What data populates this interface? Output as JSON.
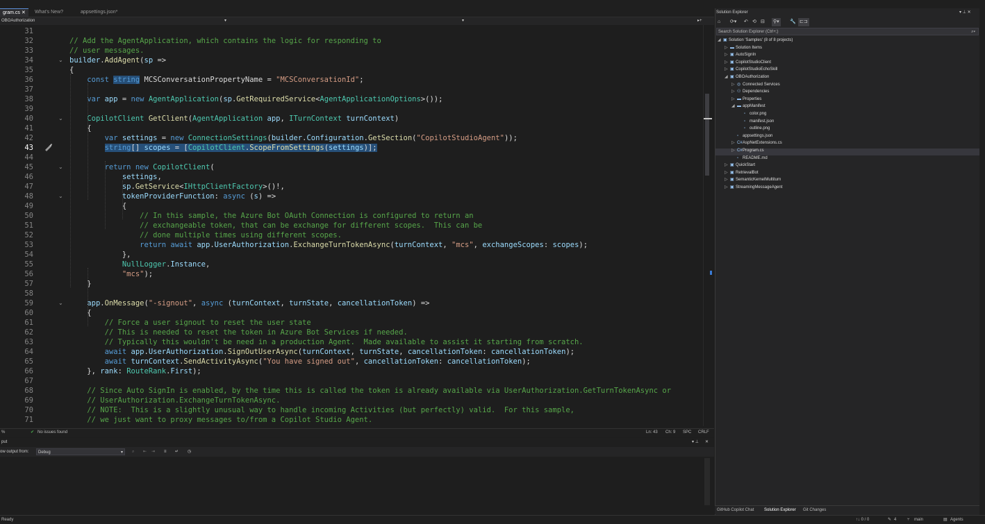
{
  "tabs": [
    {
      "label": "gram.cs",
      "active": true
    },
    {
      "label": "What's New?",
      "active": false
    },
    {
      "label": "appsettings.json*",
      "active": false
    }
  ],
  "navbar": {
    "project": "OBOAuthorization"
  },
  "code_lines": [
    {
      "n": 31,
      "t": []
    },
    {
      "n": 32,
      "t": [
        [
          "cm",
          "// Add the AgentApplication, which contains the logic for responding to"
        ]
      ]
    },
    {
      "n": 33,
      "t": [
        [
          "cm",
          "// user messages."
        ]
      ]
    },
    {
      "n": 34,
      "t": [
        [
          "pa",
          "builder"
        ],
        [
          "id",
          "."
        ],
        [
          "fn",
          "AddAgent"
        ],
        [
          "id",
          "("
        ],
        [
          "pa",
          "sp"
        ],
        [
          "id",
          " =>"
        ]
      ]
    },
    {
      "n": 35,
      "t": [
        [
          "id",
          "{"
        ]
      ]
    },
    {
      "n": 36,
      "t": [
        [
          "id",
          "    "
        ],
        [
          "kw",
          "const "
        ],
        [
          "kw sel",
          "string"
        ],
        [
          "id",
          " MCSConversationPropertyName = "
        ],
        [
          "str",
          "\"MCSConversationId\""
        ],
        [
          "id",
          ";"
        ]
      ]
    },
    {
      "n": 37,
      "t": []
    },
    {
      "n": 38,
      "t": [
        [
          "id",
          "    "
        ],
        [
          "kw",
          "var "
        ],
        [
          "pa",
          "app"
        ],
        [
          "id",
          " = "
        ],
        [
          "kw",
          "new "
        ],
        [
          "ty",
          "AgentApplication"
        ],
        [
          "id",
          "("
        ],
        [
          "pa",
          "sp"
        ],
        [
          "id",
          "."
        ],
        [
          "fn",
          "GetRequiredService"
        ],
        [
          "id",
          "<"
        ],
        [
          "ty",
          "AgentApplicationOptions"
        ],
        [
          "id",
          ">());"
        ]
      ]
    },
    {
      "n": 39,
      "t": []
    },
    {
      "n": 40,
      "t": [
        [
          "id",
          "    "
        ],
        [
          "ty",
          "CopilotClient"
        ],
        [
          "id",
          " "
        ],
        [
          "fn",
          "GetClient"
        ],
        [
          "id",
          "("
        ],
        [
          "ty",
          "AgentApplication"
        ],
        [
          "id",
          " "
        ],
        [
          "pa",
          "app"
        ],
        [
          "id",
          ", "
        ],
        [
          "ty",
          "ITurnContext"
        ],
        [
          "id",
          " "
        ],
        [
          "pa",
          "turnContext"
        ],
        [
          "id",
          ")"
        ]
      ]
    },
    {
      "n": 41,
      "t": [
        [
          "id",
          "    {"
        ]
      ]
    },
    {
      "n": 42,
      "t": [
        [
          "id",
          "        "
        ],
        [
          "kw",
          "var "
        ],
        [
          "pa",
          "settings"
        ],
        [
          "id",
          " = "
        ],
        [
          "kw",
          "new "
        ],
        [
          "ty",
          "ConnectionSettings"
        ],
        [
          "id",
          "("
        ],
        [
          "pa",
          "builder"
        ],
        [
          "id",
          "."
        ],
        [
          "pa",
          "Configuration"
        ],
        [
          "id",
          "."
        ],
        [
          "fn",
          "GetSection"
        ],
        [
          "id",
          "("
        ],
        [
          "str",
          "\"CopilotStudioAgent\""
        ],
        [
          "id",
          "));"
        ]
      ]
    },
    {
      "n": 43,
      "t": [
        [
          "id",
          "        "
        ],
        [
          "kw sel",
          "string"
        ],
        [
          "id sel",
          "[] "
        ],
        [
          "pa sel",
          "scopes"
        ],
        [
          "id sel",
          " = ["
        ],
        [
          "ty sel",
          "CopilotClient"
        ],
        [
          "id sel",
          "."
        ],
        [
          "fn sel",
          "ScopeFromSettings"
        ],
        [
          "id sel",
          "("
        ],
        [
          "pa sel",
          "settings"
        ],
        [
          "id sel",
          ")];"
        ]
      ]
    },
    {
      "n": 44,
      "t": []
    },
    {
      "n": 45,
      "t": [
        [
          "id",
          "        "
        ],
        [
          "kw",
          "return new "
        ],
        [
          "ty",
          "CopilotClient"
        ],
        [
          "id",
          "("
        ]
      ]
    },
    {
      "n": 46,
      "t": [
        [
          "id",
          "            "
        ],
        [
          "pa",
          "settings"
        ],
        [
          "id",
          ","
        ]
      ]
    },
    {
      "n": 47,
      "t": [
        [
          "id",
          "            "
        ],
        [
          "pa",
          "sp"
        ],
        [
          "id",
          "."
        ],
        [
          "fn",
          "GetService"
        ],
        [
          "id",
          "<"
        ],
        [
          "ty",
          "IHttpClientFactory"
        ],
        [
          "id",
          ">()!,"
        ]
      ]
    },
    {
      "n": 48,
      "t": [
        [
          "id",
          "            "
        ],
        [
          "pa",
          "tokenProviderFunction"
        ],
        [
          "id",
          ": "
        ],
        [
          "kw",
          "async"
        ],
        [
          "id",
          " ("
        ],
        [
          "pa",
          "s"
        ],
        [
          "id",
          ") =>"
        ]
      ]
    },
    {
      "n": 49,
      "t": [
        [
          "id",
          "            {"
        ]
      ]
    },
    {
      "n": 50,
      "t": [
        [
          "id",
          "                "
        ],
        [
          "cm",
          "// In this sample, the Azure Bot OAuth Connection is configured to return an"
        ]
      ]
    },
    {
      "n": 51,
      "t": [
        [
          "id",
          "                "
        ],
        [
          "cm",
          "// exchangeable token, that can be exchange for different scopes.  This can be"
        ]
      ]
    },
    {
      "n": 52,
      "t": [
        [
          "id",
          "                "
        ],
        [
          "cm",
          "// done multiple times using different scopes."
        ]
      ]
    },
    {
      "n": 53,
      "t": [
        [
          "id",
          "                "
        ],
        [
          "kw",
          "return await "
        ],
        [
          "pa",
          "app"
        ],
        [
          "id",
          "."
        ],
        [
          "pa",
          "UserAuthorization"
        ],
        [
          "id",
          "."
        ],
        [
          "fn",
          "ExchangeTurnTokenAsync"
        ],
        [
          "id",
          "("
        ],
        [
          "pa",
          "turnContext"
        ],
        [
          "id",
          ", "
        ],
        [
          "str",
          "\"mcs\""
        ],
        [
          "id",
          ", "
        ],
        [
          "pa",
          "exchangeScopes"
        ],
        [
          "id",
          ": "
        ],
        [
          "pa",
          "scopes"
        ],
        [
          "id",
          ");"
        ]
      ]
    },
    {
      "n": 54,
      "t": [
        [
          "id",
          "            },"
        ]
      ]
    },
    {
      "n": 55,
      "t": [
        [
          "id",
          "            "
        ],
        [
          "ty",
          "NullLogger"
        ],
        [
          "id",
          "."
        ],
        [
          "pa",
          "Instance"
        ],
        [
          "id",
          ","
        ]
      ]
    },
    {
      "n": 56,
      "t": [
        [
          "id",
          "            "
        ],
        [
          "str",
          "\"mcs\""
        ],
        [
          "id",
          ");"
        ]
      ]
    },
    {
      "n": 57,
      "t": [
        [
          "id",
          "    }"
        ]
      ]
    },
    {
      "n": 58,
      "t": []
    },
    {
      "n": 59,
      "t": [
        [
          "id",
          "    "
        ],
        [
          "pa",
          "app"
        ],
        [
          "id",
          "."
        ],
        [
          "fn",
          "OnMessage"
        ],
        [
          "id",
          "("
        ],
        [
          "str",
          "\"-signout\""
        ],
        [
          "id",
          ", "
        ],
        [
          "kw",
          "async"
        ],
        [
          "id",
          " ("
        ],
        [
          "pa",
          "turnContext"
        ],
        [
          "id",
          ", "
        ],
        [
          "pa",
          "turnState"
        ],
        [
          "id",
          ", "
        ],
        [
          "pa",
          "cancellationToken"
        ],
        [
          "id",
          ") =>"
        ]
      ]
    },
    {
      "n": 60,
      "t": [
        [
          "id",
          "    {"
        ]
      ]
    },
    {
      "n": 61,
      "t": [
        [
          "id",
          "        "
        ],
        [
          "cm",
          "// Force a user signout to reset the user state"
        ]
      ]
    },
    {
      "n": 62,
      "t": [
        [
          "id",
          "        "
        ],
        [
          "cm",
          "// This is needed to reset the token in Azure Bot Services if needed."
        ]
      ]
    },
    {
      "n": 63,
      "t": [
        [
          "id",
          "        "
        ],
        [
          "cm",
          "// Typically this wouldn't be need in a production Agent.  Made available to assist it starting from scratch."
        ]
      ]
    },
    {
      "n": 64,
      "t": [
        [
          "id",
          "        "
        ],
        [
          "kw",
          "await "
        ],
        [
          "pa",
          "app"
        ],
        [
          "id",
          "."
        ],
        [
          "pa",
          "UserAuthorization"
        ],
        [
          "id",
          "."
        ],
        [
          "fn",
          "SignOutUserAsync"
        ],
        [
          "id",
          "("
        ],
        [
          "pa",
          "turnContext"
        ],
        [
          "id",
          ", "
        ],
        [
          "pa",
          "turnState"
        ],
        [
          "id",
          ", "
        ],
        [
          "pa",
          "cancellationToken"
        ],
        [
          "id",
          ": "
        ],
        [
          "pa",
          "cancellationToken"
        ],
        [
          "id",
          ");"
        ]
      ]
    },
    {
      "n": 65,
      "t": [
        [
          "id",
          "        "
        ],
        [
          "kw",
          "await "
        ],
        [
          "pa",
          "turnContext"
        ],
        [
          "id",
          "."
        ],
        [
          "fn",
          "SendActivityAsync"
        ],
        [
          "id",
          "("
        ],
        [
          "str",
          "\"You have signed out\""
        ],
        [
          "id",
          ", "
        ],
        [
          "pa",
          "cancellationToken"
        ],
        [
          "id",
          ": "
        ],
        [
          "pa",
          "cancellationToken"
        ],
        [
          "id",
          ");"
        ]
      ]
    },
    {
      "n": 66,
      "t": [
        [
          "id",
          "    }, "
        ],
        [
          "pa",
          "rank"
        ],
        [
          "id",
          ": "
        ],
        [
          "ty",
          "RouteRank"
        ],
        [
          "id",
          "."
        ],
        [
          "pa",
          "First"
        ],
        [
          "id",
          ");"
        ]
      ]
    },
    {
      "n": 67,
      "t": []
    },
    {
      "n": 68,
      "t": [
        [
          "id",
          "    "
        ],
        [
          "cm",
          "// Since Auto SignIn is enabled, by the time this is called the token is already available via UserAuthorization.GetTurnTokenAsync or"
        ]
      ]
    },
    {
      "n": 69,
      "t": [
        [
          "id",
          "    "
        ],
        [
          "cm",
          "// UserAuthorization.ExchangeTurnTokenAsync."
        ]
      ]
    },
    {
      "n": 70,
      "t": [
        [
          "id",
          "    "
        ],
        [
          "cm",
          "// NOTE:  This is a slightly unusual way to handle incoming Activities (but perfectly) valid.  For this sample,"
        ]
      ]
    },
    {
      "n": 71,
      "t": [
        [
          "id",
          "    "
        ],
        [
          "cm",
          "// we just want to proxy messages to/from a Copilot Studio Agent."
        ]
      ]
    }
  ],
  "current_line": 43,
  "editor_status": {
    "zoom": "%",
    "issues": "No issues found",
    "ln": "Ln: 43",
    "ch": "Ch: 9",
    "spc": "SPC",
    "crlf": "CRLF"
  },
  "output": {
    "title": "put",
    "show_from_label": "ow output from:",
    "source": "Debug"
  },
  "solution_explorer": {
    "title": "Solution Explorer",
    "search_placeholder": "Search Solution Explorer (Ctrl+;)",
    "items": [
      {
        "label": "Solution 'Samples' (8 of 8 projects)",
        "depth": 0,
        "arrow": "◢",
        "icon": "▣"
      },
      {
        "label": "Solution Items",
        "depth": 1,
        "arrow": "▷",
        "icon": "▬"
      },
      {
        "label": "AutoSignIn",
        "depth": 1,
        "arrow": "▷",
        "icon": "▣"
      },
      {
        "label": "CopilotStudioClient",
        "depth": 1,
        "arrow": "▷",
        "icon": "▣"
      },
      {
        "label": "CopilotStudioEchoSkill",
        "depth": 1,
        "arrow": "▷",
        "icon": "▣"
      },
      {
        "label": "OBOAuthorization",
        "depth": 1,
        "arrow": "◢",
        "icon": "▣"
      },
      {
        "label": "Connected Services",
        "depth": 2,
        "arrow": "▷",
        "icon": "◎"
      },
      {
        "label": "Dependencies",
        "depth": 2,
        "arrow": "▷",
        "icon": "⚇"
      },
      {
        "label": "Properties",
        "depth": 2,
        "arrow": "▷",
        "icon": "▬"
      },
      {
        "label": "appManifest",
        "depth": 2,
        "arrow": "◢",
        "icon": "▬"
      },
      {
        "label": "color.png",
        "depth": 3,
        "arrow": "",
        "icon": "▫"
      },
      {
        "label": "manifest.json",
        "depth": 3,
        "arrow": "",
        "icon": "▫"
      },
      {
        "label": "outline.png",
        "depth": 3,
        "arrow": "",
        "icon": "▫"
      },
      {
        "label": "appsettings.json",
        "depth": 2,
        "arrow": "",
        "icon": "▫"
      },
      {
        "label": "AspNetExtensions.cs",
        "depth": 2,
        "arrow": "▷",
        "icon": "C#"
      },
      {
        "label": "Program.cs",
        "depth": 2,
        "arrow": "▷",
        "icon": "C#"
      },
      {
        "label": "README.md",
        "depth": 2,
        "arrow": "",
        "icon": "▫"
      },
      {
        "label": "QuickStart",
        "depth": 1,
        "arrow": "▷",
        "icon": "▣"
      },
      {
        "label": "RetrievalBot",
        "depth": 1,
        "arrow": "▷",
        "icon": "▣"
      },
      {
        "label": "SemanticKernelMultiturn",
        "depth": 1,
        "arrow": "▷",
        "icon": "▣"
      },
      {
        "label": "StreamingMessageAgent",
        "depth": 1,
        "arrow": "▷",
        "icon": "▣"
      }
    ],
    "bottom_tabs": [
      "GitHub Copilot Chat",
      "Solution Explorer",
      "Git Changes"
    ]
  },
  "statusbar": {
    "left": "Ready",
    "errors": "↑↓ 0 / 0",
    "pencil": "4",
    "branch": "main",
    "agents": "Agents"
  }
}
